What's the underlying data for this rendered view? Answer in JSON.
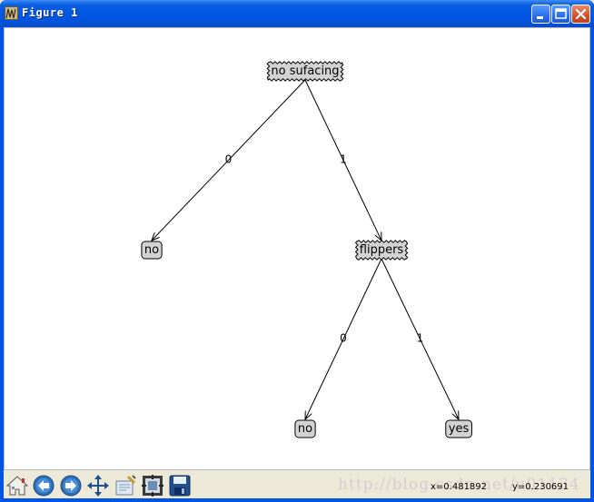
{
  "window": {
    "title": "Figure 1",
    "buttons": {
      "minimize": "minimize",
      "maximize": "maximize",
      "close": "close"
    }
  },
  "tree": {
    "decision_nodes": [
      {
        "id": "root",
        "label": "no sufacing"
      },
      {
        "id": "flippers",
        "label": "flippers"
      }
    ],
    "leaf_nodes": [
      {
        "id": "leaf-no-1",
        "label": "no"
      },
      {
        "id": "leaf-no-2",
        "label": "no"
      },
      {
        "id": "leaf-yes",
        "label": "yes"
      }
    ],
    "edges": [
      {
        "from": "root",
        "to": "leaf-no-1",
        "label": "0"
      },
      {
        "from": "root",
        "to": "flippers",
        "label": "1"
      },
      {
        "from": "flippers",
        "to": "leaf-no-2",
        "label": "0"
      },
      {
        "from": "flippers",
        "to": "leaf-yes",
        "label": "1"
      }
    ]
  },
  "toolbar": {
    "tools": [
      "home-icon",
      "back-arrow-icon",
      "forward-arrow-icon",
      "pan-icon",
      "zoom-rect-icon",
      "subplots-icon",
      "save-icon"
    ],
    "coord_x": "x=0.481892",
    "coord_y": "y=0.230691",
    "watermark": "http://blog.csdn.net/u01134"
  },
  "colors": {
    "titlebar": "#0058e6",
    "node_fill": "#d3d3d3",
    "canvas": "#ffffff",
    "chrome": "#ece9d8"
  }
}
